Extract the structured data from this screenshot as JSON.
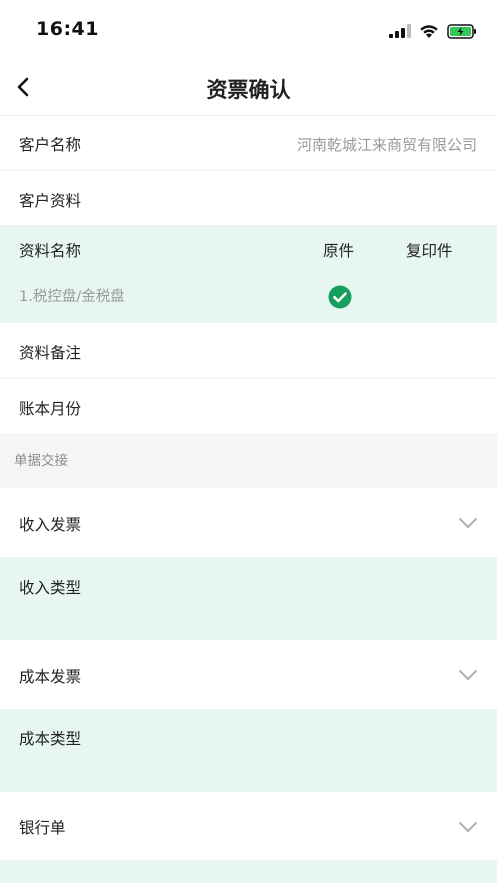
{
  "status_bar": {
    "time": "16:41"
  },
  "nav": {
    "title": "资票确认"
  },
  "customer": {
    "name_label": "客户名称",
    "name_value": "河南乾城江来商贸有限公司"
  },
  "customer_docs": {
    "label": "客户资料"
  },
  "docs_table": {
    "headers": {
      "name": "资料名称",
      "original": "原件",
      "copy": "复印件"
    },
    "rows": [
      {
        "name": "1.税控盘/金税盘",
        "original": true,
        "copy": false
      }
    ]
  },
  "doc_remark": {
    "label": "资料备注"
  },
  "ledger_month": {
    "label": "账本月份"
  },
  "section": {
    "title": "单据交接"
  },
  "income_invoice": {
    "label": "收入发票"
  },
  "income_type": {
    "label": "收入类型"
  },
  "cost_invoice": {
    "label": "成本发票"
  },
  "cost_type": {
    "label": "成本类型"
  },
  "bank_statement": {
    "label": "银行单"
  },
  "colors": {
    "accent": "#17a05d",
    "tint": "#e8f6f1",
    "section_bg": "#f5f5f5"
  }
}
